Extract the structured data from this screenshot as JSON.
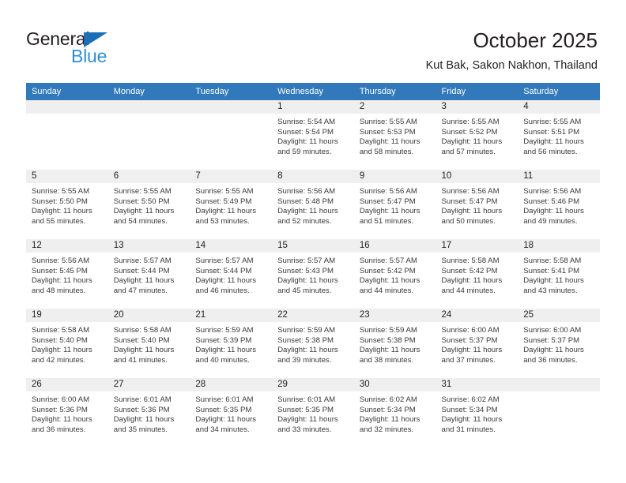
{
  "brand": {
    "name_part1": "General",
    "name_part2": "Blue",
    "triangle_color": "#1b6fb5",
    "blue_color": "#2e8fd4"
  },
  "header": {
    "title": "October 2025",
    "subtitle": "Kut Bak, Sakon Nakhon, Thailand",
    "accent_color": "#3179ba",
    "band_color": "#efeff0"
  },
  "weekday_headers": [
    "Sunday",
    "Monday",
    "Tuesday",
    "Wednesday",
    "Thursday",
    "Friday",
    "Saturday"
  ],
  "weeks": [
    [
      {
        "day": "",
        "sunrise": "",
        "sunset": "",
        "daylight": ""
      },
      {
        "day": "",
        "sunrise": "",
        "sunset": "",
        "daylight": ""
      },
      {
        "day": "",
        "sunrise": "",
        "sunset": "",
        "daylight": ""
      },
      {
        "day": "1",
        "sunrise": "Sunrise: 5:54 AM",
        "sunset": "Sunset: 5:54 PM",
        "daylight": "Daylight: 11 hours and 59 minutes."
      },
      {
        "day": "2",
        "sunrise": "Sunrise: 5:55 AM",
        "sunset": "Sunset: 5:53 PM",
        "daylight": "Daylight: 11 hours and 58 minutes."
      },
      {
        "day": "3",
        "sunrise": "Sunrise: 5:55 AM",
        "sunset": "Sunset: 5:52 PM",
        "daylight": "Daylight: 11 hours and 57 minutes."
      },
      {
        "day": "4",
        "sunrise": "Sunrise: 5:55 AM",
        "sunset": "Sunset: 5:51 PM",
        "daylight": "Daylight: 11 hours and 56 minutes."
      }
    ],
    [
      {
        "day": "5",
        "sunrise": "Sunrise: 5:55 AM",
        "sunset": "Sunset: 5:50 PM",
        "daylight": "Daylight: 11 hours and 55 minutes."
      },
      {
        "day": "6",
        "sunrise": "Sunrise: 5:55 AM",
        "sunset": "Sunset: 5:50 PM",
        "daylight": "Daylight: 11 hours and 54 minutes."
      },
      {
        "day": "7",
        "sunrise": "Sunrise: 5:55 AM",
        "sunset": "Sunset: 5:49 PM",
        "daylight": "Daylight: 11 hours and 53 minutes."
      },
      {
        "day": "8",
        "sunrise": "Sunrise: 5:56 AM",
        "sunset": "Sunset: 5:48 PM",
        "daylight": "Daylight: 11 hours and 52 minutes."
      },
      {
        "day": "9",
        "sunrise": "Sunrise: 5:56 AM",
        "sunset": "Sunset: 5:47 PM",
        "daylight": "Daylight: 11 hours and 51 minutes."
      },
      {
        "day": "10",
        "sunrise": "Sunrise: 5:56 AM",
        "sunset": "Sunset: 5:47 PM",
        "daylight": "Daylight: 11 hours and 50 minutes."
      },
      {
        "day": "11",
        "sunrise": "Sunrise: 5:56 AM",
        "sunset": "Sunset: 5:46 PM",
        "daylight": "Daylight: 11 hours and 49 minutes."
      }
    ],
    [
      {
        "day": "12",
        "sunrise": "Sunrise: 5:56 AM",
        "sunset": "Sunset: 5:45 PM",
        "daylight": "Daylight: 11 hours and 48 minutes."
      },
      {
        "day": "13",
        "sunrise": "Sunrise: 5:57 AM",
        "sunset": "Sunset: 5:44 PM",
        "daylight": "Daylight: 11 hours and 47 minutes."
      },
      {
        "day": "14",
        "sunrise": "Sunrise: 5:57 AM",
        "sunset": "Sunset: 5:44 PM",
        "daylight": "Daylight: 11 hours and 46 minutes."
      },
      {
        "day": "15",
        "sunrise": "Sunrise: 5:57 AM",
        "sunset": "Sunset: 5:43 PM",
        "daylight": "Daylight: 11 hours and 45 minutes."
      },
      {
        "day": "16",
        "sunrise": "Sunrise: 5:57 AM",
        "sunset": "Sunset: 5:42 PM",
        "daylight": "Daylight: 11 hours and 44 minutes."
      },
      {
        "day": "17",
        "sunrise": "Sunrise: 5:58 AM",
        "sunset": "Sunset: 5:42 PM",
        "daylight": "Daylight: 11 hours and 44 minutes."
      },
      {
        "day": "18",
        "sunrise": "Sunrise: 5:58 AM",
        "sunset": "Sunset: 5:41 PM",
        "daylight": "Daylight: 11 hours and 43 minutes."
      }
    ],
    [
      {
        "day": "19",
        "sunrise": "Sunrise: 5:58 AM",
        "sunset": "Sunset: 5:40 PM",
        "daylight": "Daylight: 11 hours and 42 minutes."
      },
      {
        "day": "20",
        "sunrise": "Sunrise: 5:58 AM",
        "sunset": "Sunset: 5:40 PM",
        "daylight": "Daylight: 11 hours and 41 minutes."
      },
      {
        "day": "21",
        "sunrise": "Sunrise: 5:59 AM",
        "sunset": "Sunset: 5:39 PM",
        "daylight": "Daylight: 11 hours and 40 minutes."
      },
      {
        "day": "22",
        "sunrise": "Sunrise: 5:59 AM",
        "sunset": "Sunset: 5:38 PM",
        "daylight": "Daylight: 11 hours and 39 minutes."
      },
      {
        "day": "23",
        "sunrise": "Sunrise: 5:59 AM",
        "sunset": "Sunset: 5:38 PM",
        "daylight": "Daylight: 11 hours and 38 minutes."
      },
      {
        "day": "24",
        "sunrise": "Sunrise: 6:00 AM",
        "sunset": "Sunset: 5:37 PM",
        "daylight": "Daylight: 11 hours and 37 minutes."
      },
      {
        "day": "25",
        "sunrise": "Sunrise: 6:00 AM",
        "sunset": "Sunset: 5:37 PM",
        "daylight": "Daylight: 11 hours and 36 minutes."
      }
    ],
    [
      {
        "day": "26",
        "sunrise": "Sunrise: 6:00 AM",
        "sunset": "Sunset: 5:36 PM",
        "daylight": "Daylight: 11 hours and 36 minutes."
      },
      {
        "day": "27",
        "sunrise": "Sunrise: 6:01 AM",
        "sunset": "Sunset: 5:36 PM",
        "daylight": "Daylight: 11 hours and 35 minutes."
      },
      {
        "day": "28",
        "sunrise": "Sunrise: 6:01 AM",
        "sunset": "Sunset: 5:35 PM",
        "daylight": "Daylight: 11 hours and 34 minutes."
      },
      {
        "day": "29",
        "sunrise": "Sunrise: 6:01 AM",
        "sunset": "Sunset: 5:35 PM",
        "daylight": "Daylight: 11 hours and 33 minutes."
      },
      {
        "day": "30",
        "sunrise": "Sunrise: 6:02 AM",
        "sunset": "Sunset: 5:34 PM",
        "daylight": "Daylight: 11 hours and 32 minutes."
      },
      {
        "day": "31",
        "sunrise": "Sunrise: 6:02 AM",
        "sunset": "Sunset: 5:34 PM",
        "daylight": "Daylight: 11 hours and 31 minutes."
      },
      {
        "day": "",
        "sunrise": "",
        "sunset": "",
        "daylight": ""
      }
    ]
  ]
}
